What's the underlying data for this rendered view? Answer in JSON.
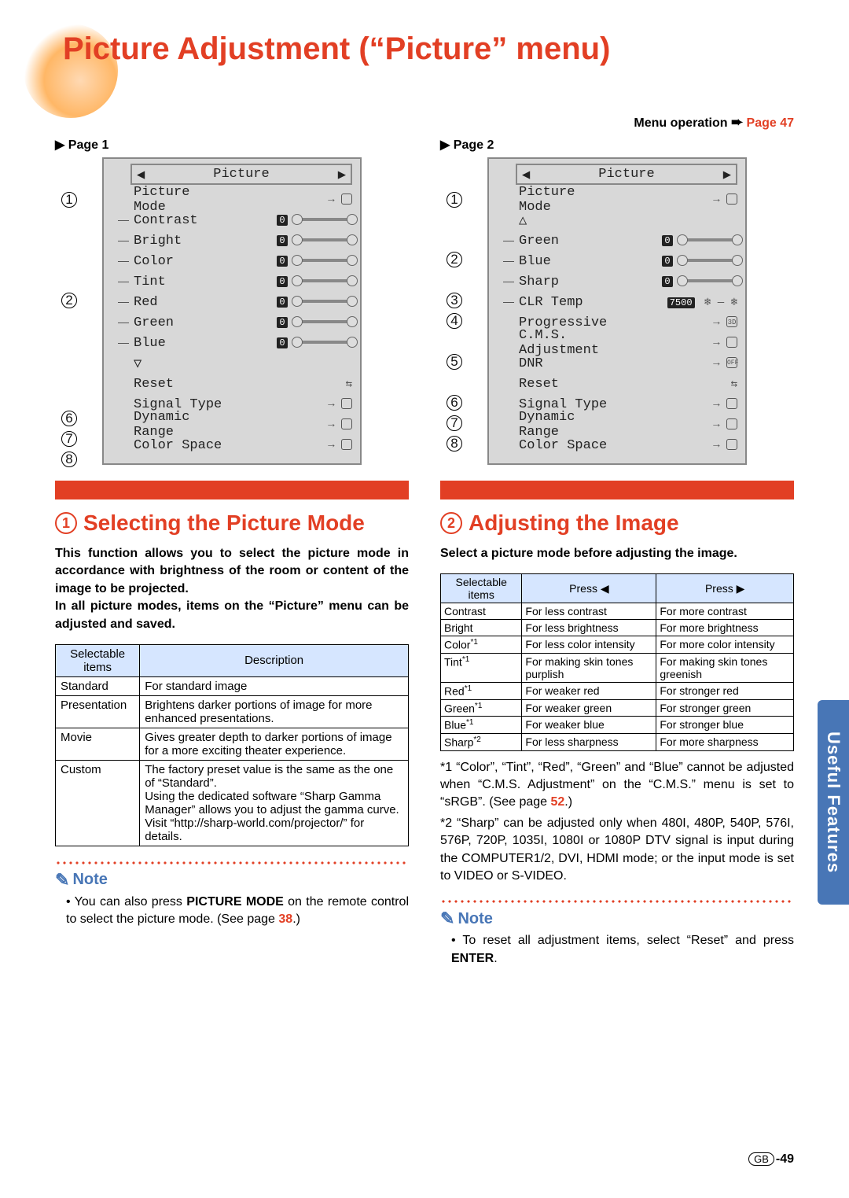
{
  "title": "Picture Adjustment (“Picture” menu)",
  "menuop": {
    "label": "Menu operation",
    "page": "Page 47"
  },
  "sidetab": "Useful Features",
  "page1": {
    "label": "Page 1",
    "header": "Picture",
    "callouts": {
      "c1": "1",
      "c2": "2",
      "c6": "6",
      "c7": "7",
      "c8": "8"
    },
    "rows": [
      {
        "lbl": "Picture Mode",
        "type": "arrow"
      },
      {
        "lbl": "Contrast",
        "type": "slider",
        "val": "0"
      },
      {
        "lbl": "Bright",
        "type": "slider",
        "val": "0"
      },
      {
        "lbl": "Color",
        "type": "slider",
        "val": "0"
      },
      {
        "lbl": "Tint",
        "type": "slider",
        "val": "0"
      },
      {
        "lbl": "Red",
        "type": "slider",
        "val": "0"
      },
      {
        "lbl": "Green",
        "type": "slider",
        "val": "0"
      },
      {
        "lbl": "Blue",
        "type": "slider",
        "val": "0"
      },
      {
        "lbl": "▽",
        "type": "none"
      },
      {
        "lbl": "Reset",
        "type": "reset"
      },
      {
        "lbl": "Signal Type",
        "type": "arrow"
      },
      {
        "lbl": "Dynamic Range",
        "type": "arrow"
      },
      {
        "lbl": "Color Space",
        "type": "arrow"
      }
    ]
  },
  "page2": {
    "label": "Page 2",
    "header": "Picture",
    "callouts": {
      "c1": "1",
      "c2": "2",
      "c3": "3",
      "c4": "4",
      "c5": "5",
      "c6": "6",
      "c7": "7",
      "c8": "8"
    },
    "rows": [
      {
        "lbl": "Picture Mode",
        "type": "arrow"
      },
      {
        "lbl": "△",
        "type": "none"
      },
      {
        "lbl": "Green",
        "type": "slider",
        "val": "0"
      },
      {
        "lbl": "Blue",
        "type": "slider",
        "val": "0"
      },
      {
        "lbl": "Sharp",
        "type": "slider",
        "val": "0"
      },
      {
        "lbl": "CLR Temp",
        "type": "temp",
        "val": "7500"
      },
      {
        "lbl": "Progressive",
        "type": "arrow3d"
      },
      {
        "lbl": "C.M.S. Adjustment",
        "type": "arrow"
      },
      {
        "lbl": "DNR",
        "type": "arrowoff"
      },
      {
        "lbl": "Reset",
        "type": "reset"
      },
      {
        "lbl": "Signal Type",
        "type": "arrow"
      },
      {
        "lbl": "Dynamic Range",
        "type": "arrow"
      },
      {
        "lbl": "Color Space",
        "type": "arrow"
      }
    ]
  },
  "sec1": {
    "num": "1",
    "title": "Selecting the Picture Mode",
    "intro": "This function allows you to select the picture mode in accordance with brightness of the room or content of the image to be projected.\nIn all picture modes, items on the “Picture” menu can be adjusted and saved.",
    "table_h": [
      "Selectable items",
      "Description"
    ],
    "rows": [
      [
        "Standard",
        "For standard image"
      ],
      [
        "Presentation",
        "Brightens darker portions of image for more enhanced presentations."
      ],
      [
        "Movie",
        "Gives greater depth to darker portions of image for a more exciting theater experience."
      ],
      [
        "Custom",
        "The factory preset value is the same as the one of “Standard”.\nUsing the dedicated software “Sharp Gamma Manager” allows you to adjust the gamma curve.\nVisit “http://sharp-world.com/projector/” for details."
      ]
    ],
    "note_h": "Note",
    "note": "You can also press PICTURE MODE on the remote control to select the picture mode. (See page 38.)"
  },
  "sec2": {
    "num": "2",
    "title": "Adjusting the Image",
    "intro": "Select a picture mode before adjusting the image.",
    "table_h": [
      "Selectable items",
      "Press ◀",
      "Press ▶"
    ],
    "rows": [
      [
        "Contrast",
        "For less contrast",
        "For more contrast"
      ],
      [
        "Bright",
        "For less brightness",
        "For more brightness"
      ],
      [
        "Color*1",
        "For less color intensity",
        "For more color intensity"
      ],
      [
        "Tint*1",
        "For making skin tones purplish",
        "For making skin tones greenish"
      ],
      [
        "Red*1",
        "For weaker red",
        "For stronger red"
      ],
      [
        "Green*1",
        "For weaker green",
        "For stronger green"
      ],
      [
        "Blue*1",
        "For weaker blue",
        "For stronger blue"
      ],
      [
        "Sharp*2",
        "For less sharpness",
        "For more sharpness"
      ]
    ],
    "fn1": "*1 “Color”, “Tint”, “Red”, “Green” and “Blue” cannot be adjusted when “C.M.S. Adjustment” on the “C.M.S.” menu is set to “sRGB”. (See page 52.)",
    "fn2": "*2 “Sharp” can be adjusted only when 480I, 480P, 540P, 576I, 576P, 720P, 1035I, 1080I or 1080P DTV signal is input during the COMPUTER1/2, DVI, HDMI mode; or the input mode is set to VIDEO or S-VIDEO.",
    "note_h": "Note",
    "note": "To reset all adjustment items, select “Reset” and press ENTER."
  },
  "pgnum": {
    "gb": "GB",
    "num": "-49"
  }
}
